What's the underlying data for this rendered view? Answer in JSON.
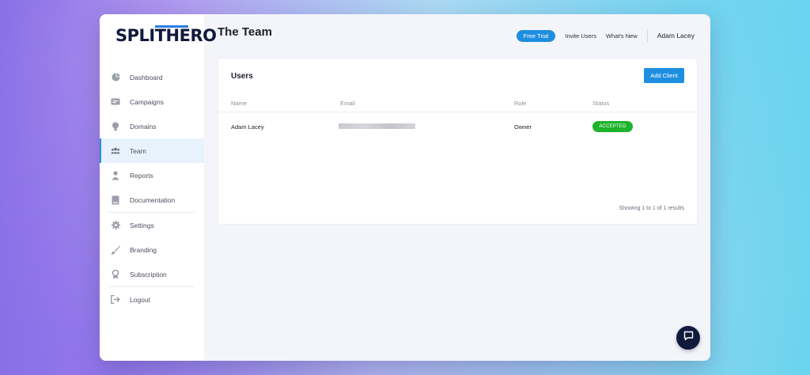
{
  "brand": {
    "logo_part1": "SPLIT",
    "logo_part2": "HERO"
  },
  "sidebar": {
    "items": [
      {
        "label": "Dashboard",
        "icon": "dashboard-icon"
      },
      {
        "label": "Campaigns",
        "icon": "campaigns-icon"
      },
      {
        "label": "Domains",
        "icon": "domains-icon"
      },
      {
        "label": "Team",
        "icon": "team-icon",
        "active": true
      },
      {
        "label": "Reports",
        "icon": "reports-icon"
      },
      {
        "label": "Documentation",
        "icon": "documentation-icon"
      },
      {
        "label": "Settings",
        "icon": "gear-icon"
      },
      {
        "label": "Branding",
        "icon": "brush-icon"
      },
      {
        "label": "Subscription",
        "icon": "award-icon"
      },
      {
        "label": "Logout",
        "icon": "logout-icon"
      }
    ]
  },
  "header": {
    "title": "The Team",
    "free_trial": "Free Trial",
    "invite_users": "Invite Users",
    "whats_new": "What's New",
    "user_name": "Adam Lacey"
  },
  "users_card": {
    "title": "Users",
    "add_client": "Add Client",
    "columns": [
      "Name",
      "Email",
      "Role",
      "Status"
    ],
    "rows": [
      {
        "name": "Adam Lacey",
        "email": "",
        "role": "Owner",
        "status": "ACCEPTED"
      }
    ],
    "results_text": "Showing 1 to 1 of 1 results"
  },
  "colors": {
    "accent": "#1e8fe0",
    "status_accepted": "#1db32a",
    "brand_dark": "#0f1a3c"
  }
}
